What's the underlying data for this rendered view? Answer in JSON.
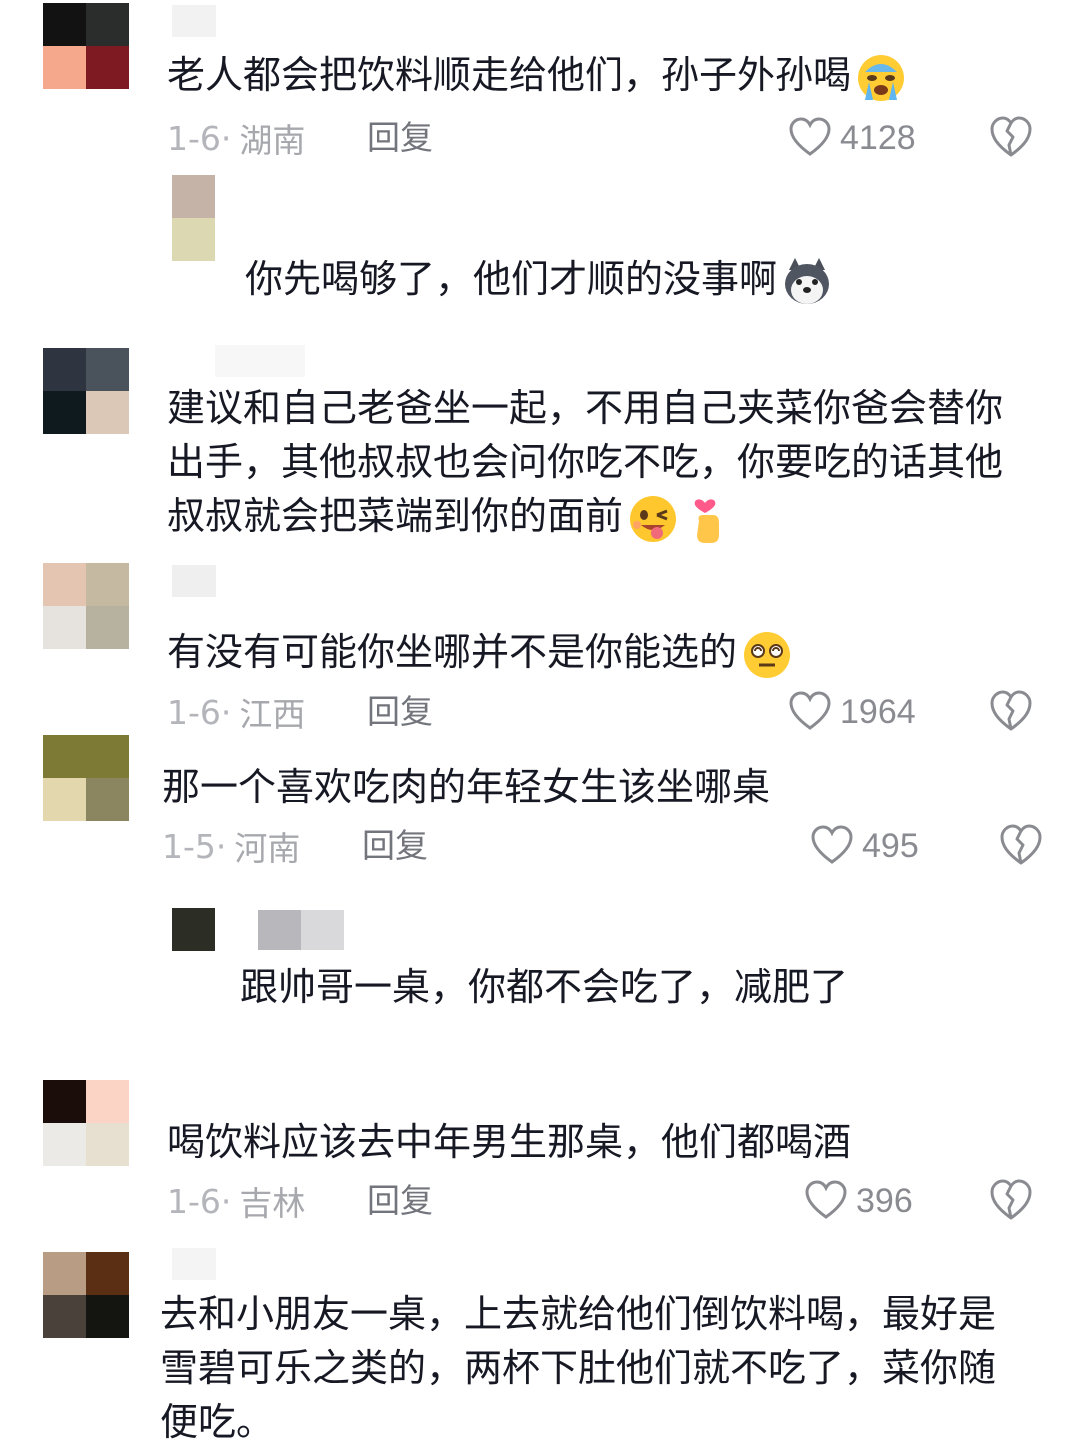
{
  "colors": {
    "text": "#161823",
    "meta": "#a7a8ad",
    "reply": "#73757c",
    "icon": "#8a8b91"
  },
  "comments": [
    {
      "text": "老人都会把饮料顺走给他们，孙子外孙喝",
      "emoji": "crying-face",
      "date": "1-6·",
      "location": "湖南",
      "reply_label": "回复",
      "likes": "4128"
    },
    {
      "text": "你先喝够了，他们才顺的没事啊",
      "emoji": "husky-dog"
    },
    {
      "text": "建议和自己老爸坐一起，不用自己夹菜你爸会替你出手，其他叔叔也会问你吃不吃，你要吃的话其他叔叔就会把菜端到你的面前",
      "emoji": "winking-tongue-face",
      "emoji2": "finger-heart"
    },
    {
      "text": "有没有可能你坐哪并不是你能选的",
      "emoji": "dizzy-face",
      "date": "1-6·",
      "location": "江西",
      "reply_label": "回复",
      "likes": "1964"
    },
    {
      "text": "那一个喜欢吃肉的年轻女生该坐哪桌",
      "date": "1-5·",
      "location": "河南",
      "reply_label": "回复",
      "likes": "495"
    },
    {
      "text": "跟帅哥一桌，你都不会吃了，减肥了"
    },
    {
      "text": "喝饮料应该去中年男生那桌，他们都喝酒",
      "date": "1-6·",
      "location": "吉林",
      "reply_label": "回复",
      "likes": "396"
    },
    {
      "text": "去和小朋友一桌，上去就给他们倒饮料喝，最好是雪碧可乐之类的，两杯下肚他们就不吃了，菜你随便吃。"
    }
  ]
}
